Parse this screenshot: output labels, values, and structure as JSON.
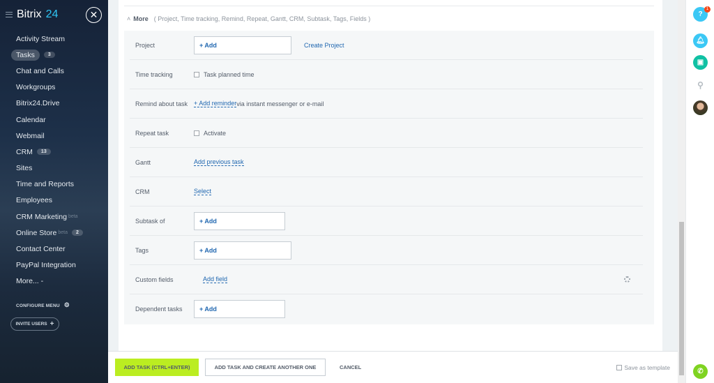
{
  "sidebar": {
    "logo_text": "Bitrix",
    "logo_num": "24",
    "items": [
      {
        "label": "Activity Stream"
      },
      {
        "label": "Tasks",
        "count": "3",
        "active": true
      },
      {
        "label": "Chat and Calls"
      },
      {
        "label": "Workgroups"
      },
      {
        "label": "Bitrix24.Drive"
      },
      {
        "label": "Calendar"
      },
      {
        "label": "Webmail"
      },
      {
        "label": "CRM",
        "count": "13"
      },
      {
        "label": "Sites"
      },
      {
        "label": "Time and Reports"
      },
      {
        "label": "Employees"
      },
      {
        "label": "CRM Marketing",
        "beta": "beta"
      },
      {
        "label": "Online Store",
        "beta": "beta",
        "count": "2"
      },
      {
        "label": "Contact Center"
      },
      {
        "label": "PayPal Integration"
      },
      {
        "label": "More... -"
      }
    ],
    "configure": "CONFIGURE MENU",
    "invite": "INVITE USERS"
  },
  "more": {
    "label": "More",
    "list": "( Project,  Time tracking,  Remind,  Repeat,  Gantt,  CRM,  Subtask,  Tags,  Fields )"
  },
  "rows": {
    "project": {
      "label": "Project",
      "add": "+ Add",
      "link": "Create Project"
    },
    "time": {
      "label": "Time tracking",
      "check": "Task planned time"
    },
    "remind": {
      "label": "Remind about task",
      "link": "+ Add reminder",
      "suffix": " via instant messenger or e-mail"
    },
    "repeat": {
      "label": "Repeat task",
      "check": "Activate"
    },
    "gantt": {
      "label": "Gantt",
      "link": "Add previous task"
    },
    "crm": {
      "label": "CRM",
      "link": "Select"
    },
    "subtask": {
      "label": "Subtask of",
      "add": "+ Add"
    },
    "tags": {
      "label": "Tags",
      "add": "+ Add"
    },
    "custom": {
      "label": "Custom fields",
      "link": "Add field"
    },
    "dependent": {
      "label": "Dependent tasks",
      "add": "+ Add"
    }
  },
  "footer": {
    "add": "ADD TASK (CTRL+ENTER)",
    "add_another": "ADD TASK AND CREATE ANOTHER ONE",
    "cancel": "CANCEL",
    "template": "Save as template"
  },
  "right": {
    "help_badge": "1",
    "colors": {
      "help": "#3bc8f5",
      "bell": "#3bc8f5",
      "chat": "#10c1a4",
      "phone": "#7fd321"
    }
  }
}
